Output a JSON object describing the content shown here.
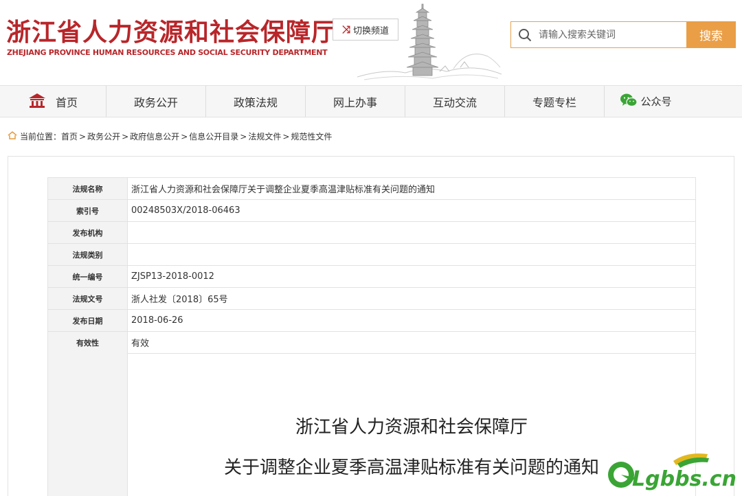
{
  "header": {
    "title": "浙江省人力资源和社会保障厅",
    "subtitle": "ZHEJIANG PROVINCE HUMAN RESOURCES AND SOCIAL SECURITY DEPARTMENT",
    "switch_label": "切换频道",
    "search_placeholder": "请输入搜索关键词",
    "search_button": "搜索"
  },
  "nav": {
    "items": [
      {
        "label": "首页",
        "icon": "home-icon"
      },
      {
        "label": "政务公开"
      },
      {
        "label": "政策法规"
      },
      {
        "label": "网上办事"
      },
      {
        "label": "互动交流"
      },
      {
        "label": "专题专栏"
      },
      {
        "label": "公众号",
        "icon": "wechat-icon"
      }
    ]
  },
  "breadcrumb": {
    "prefix": "当前位置：",
    "items": [
      "首页",
      "政务公开",
      "政府信息公开",
      "信息公开目录",
      "法规文件",
      "规范性文件"
    ],
    "separator": ">"
  },
  "info": {
    "rows": [
      {
        "label": "法规名称",
        "value": "浙江省人力资源和社会保障厅关于调整企业夏季高温津贴标准有关问题的通知"
      },
      {
        "label": "索引号",
        "value": "00248503X/2018-06463"
      },
      {
        "label": "发布机构",
        "value": ""
      },
      {
        "label": "法规类别",
        "value": ""
      },
      {
        "label": "统一编号",
        "value": "ZJSP13-2018-0012"
      },
      {
        "label": "法规文号",
        "value": "浙人社发〔2018〕65号"
      },
      {
        "label": "发布日期",
        "value": "2018-06-26"
      },
      {
        "label": "有效性",
        "value": "有效"
      }
    ]
  },
  "document": {
    "title_line1": "浙江省人力资源和社会保障厅",
    "title_line2": "关于调整企业夏季高温津贴标准有关问题的通知"
  },
  "watermark": {
    "text": "Lgbbs.cn"
  },
  "colors": {
    "brand_red": "#b8262a",
    "accent_orange": "#ea9e46",
    "watermark_green": "#3aa535"
  }
}
